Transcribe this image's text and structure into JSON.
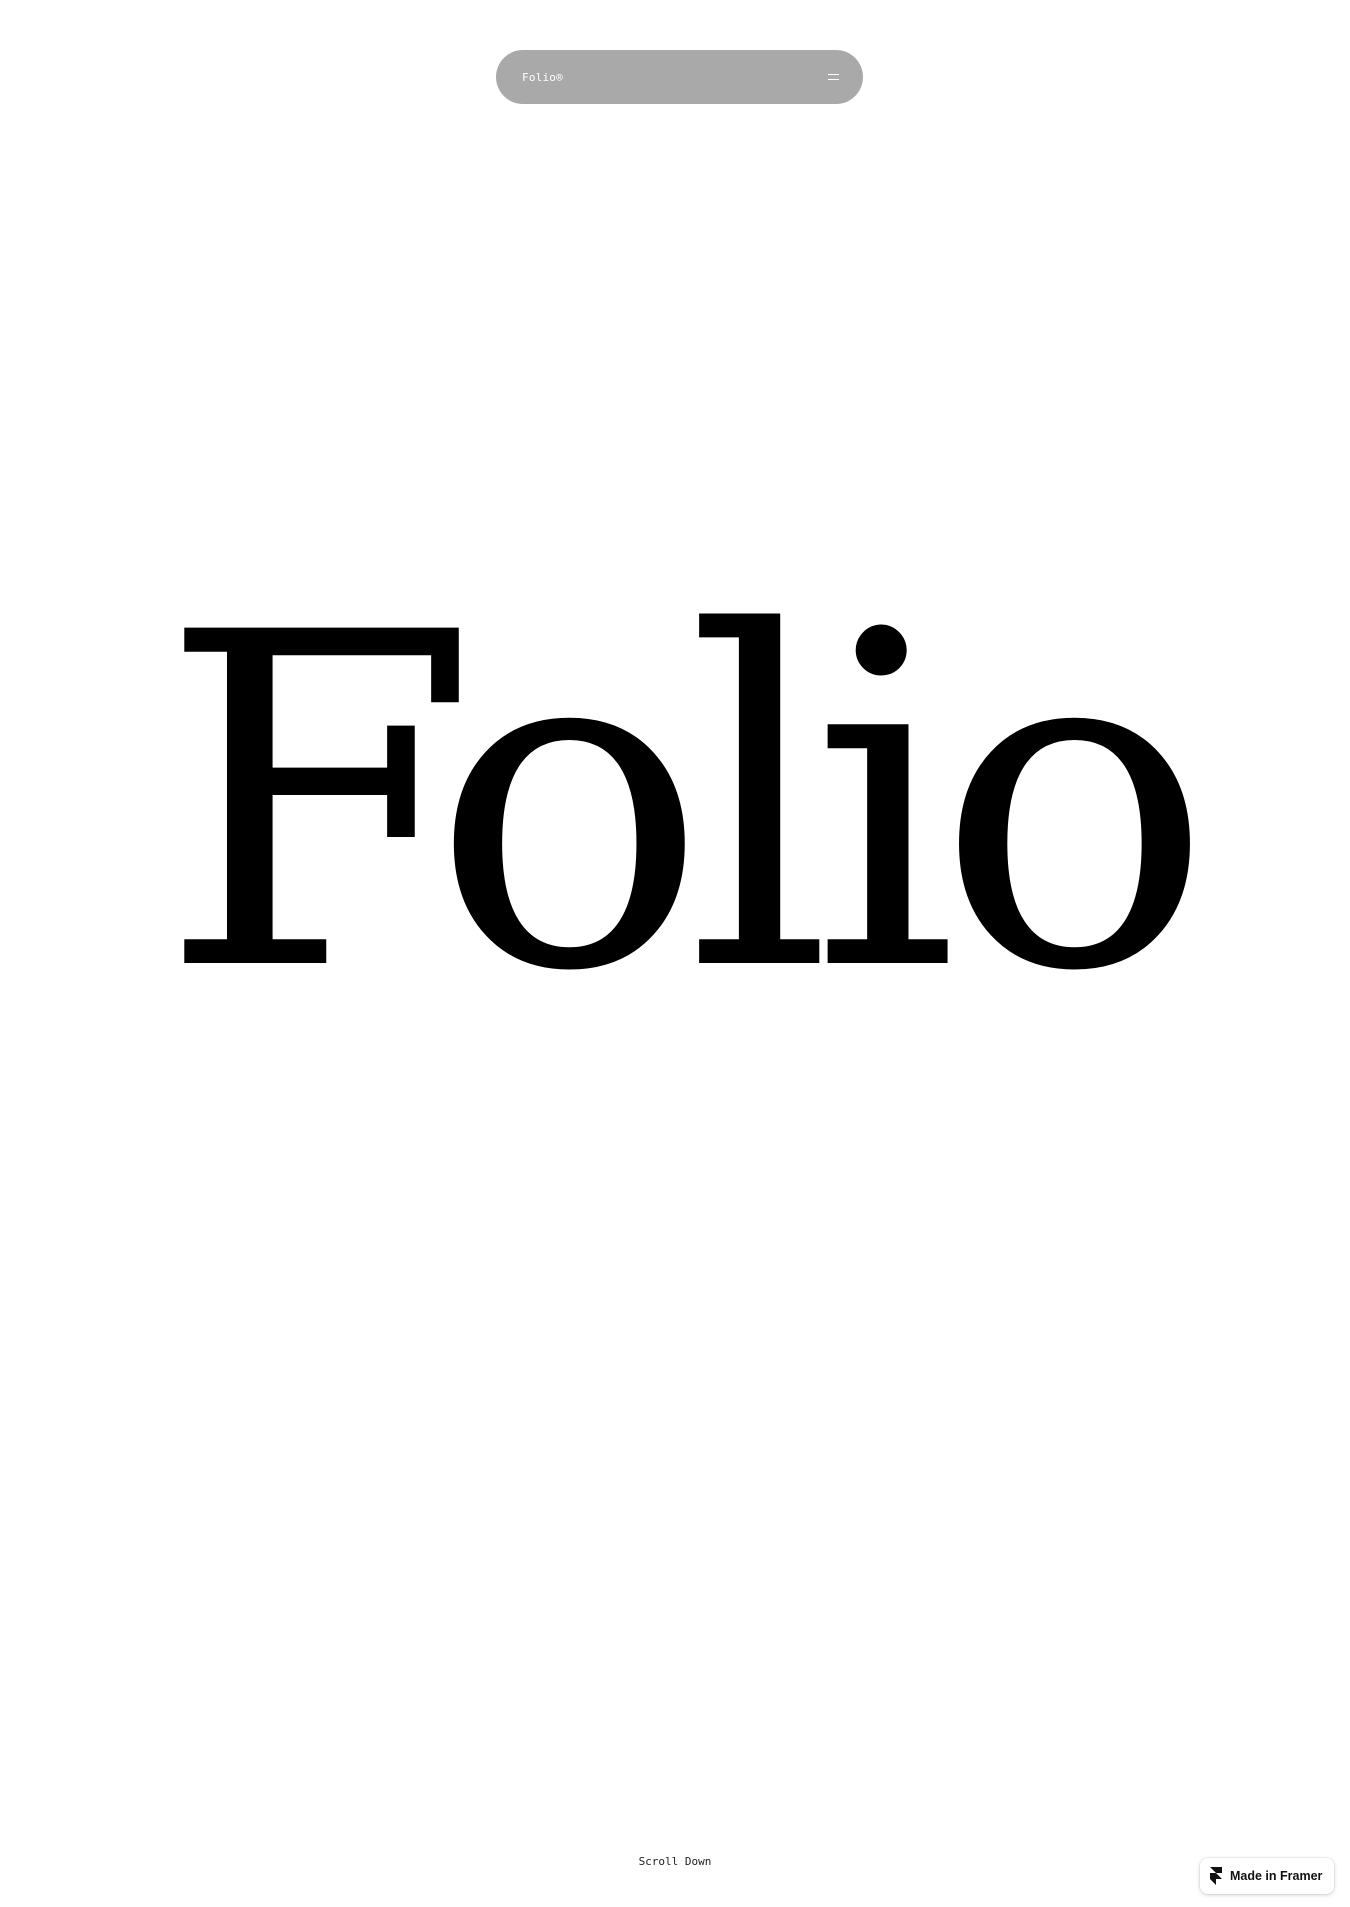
{
  "nav": {
    "brand": "Folio®",
    "menu_icon": "hamburger-menu-icon"
  },
  "hero": {
    "title": "Folio"
  },
  "footer": {
    "scroll_label": "Scroll Down"
  },
  "badge": {
    "label": "Made in Framer",
    "icon": "framer-logo-icon"
  },
  "colors": {
    "nav_background": "#a9a9a9",
    "text": "#000000",
    "background": "#ffffff"
  }
}
